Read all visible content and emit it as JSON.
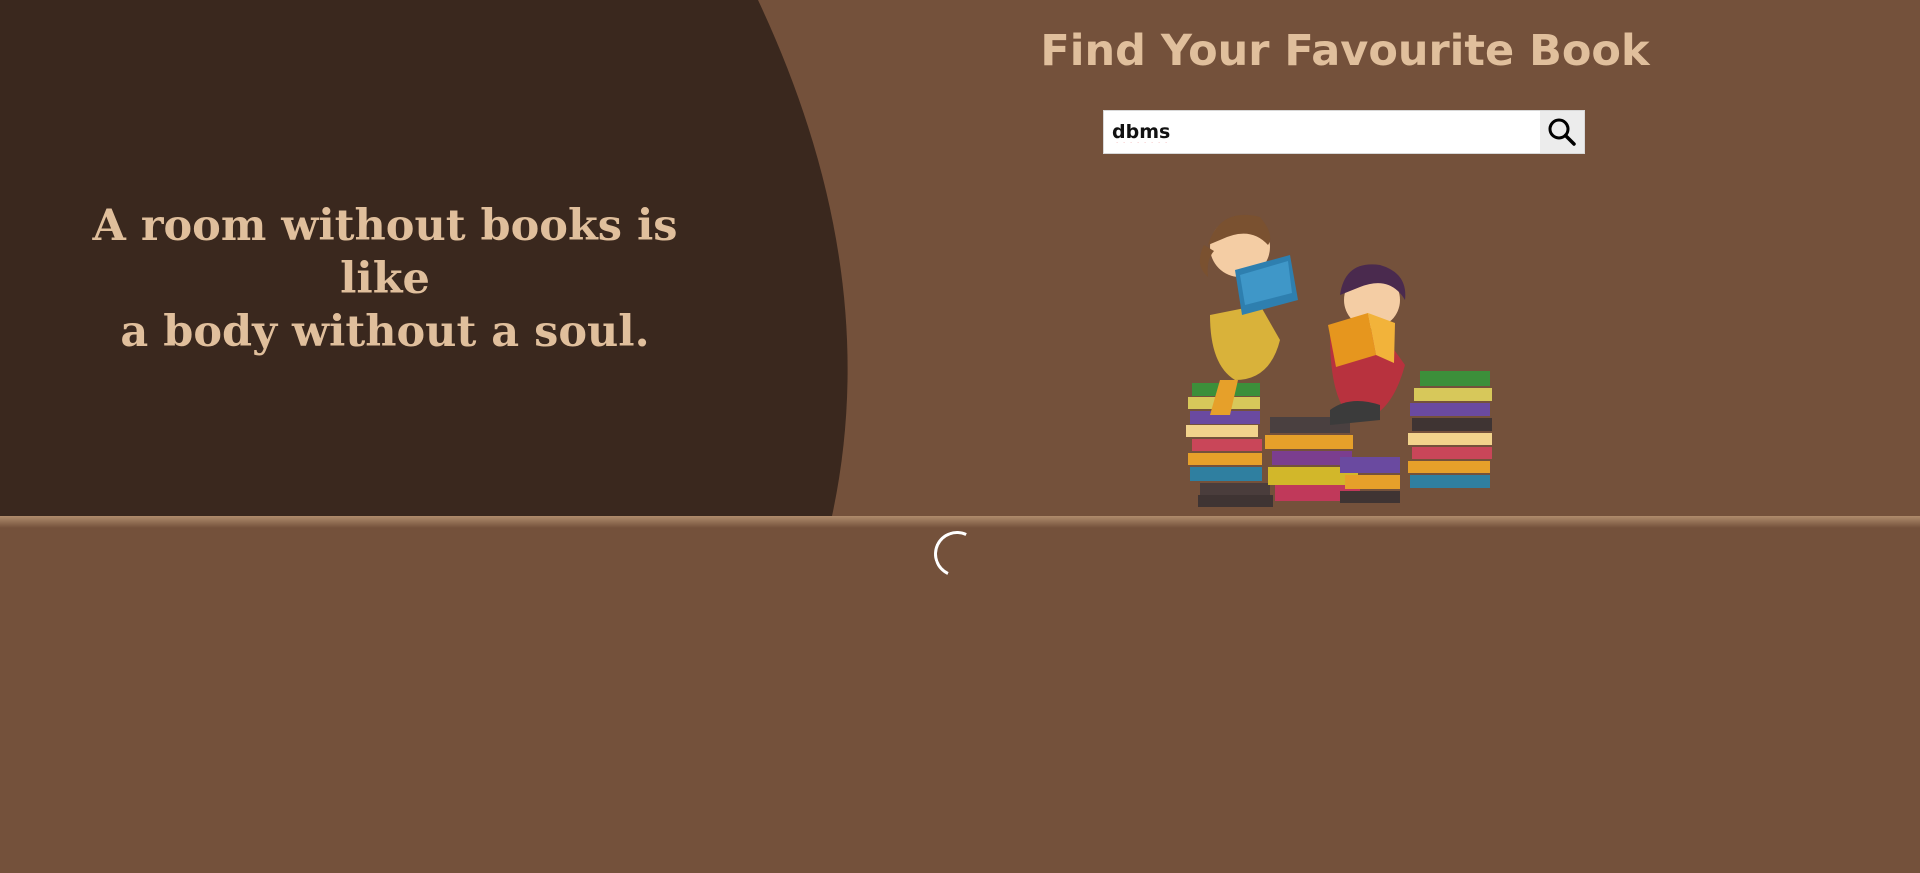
{
  "hero": {
    "quote_line1": "A room without books is like",
    "quote_line2": "a body without a soul.",
    "heading": "Find Your Favourite Book"
  },
  "search": {
    "value": "dbms",
    "button_icon": "search-icon"
  },
  "illustration": {
    "icon": "kids-reading-books-illustration"
  },
  "results": {
    "status_icon": "loading-spinner-icon"
  },
  "colors": {
    "background": "#74513b",
    "dark_panel": "#3a281e",
    "accent_text": "#e0bf9c"
  }
}
